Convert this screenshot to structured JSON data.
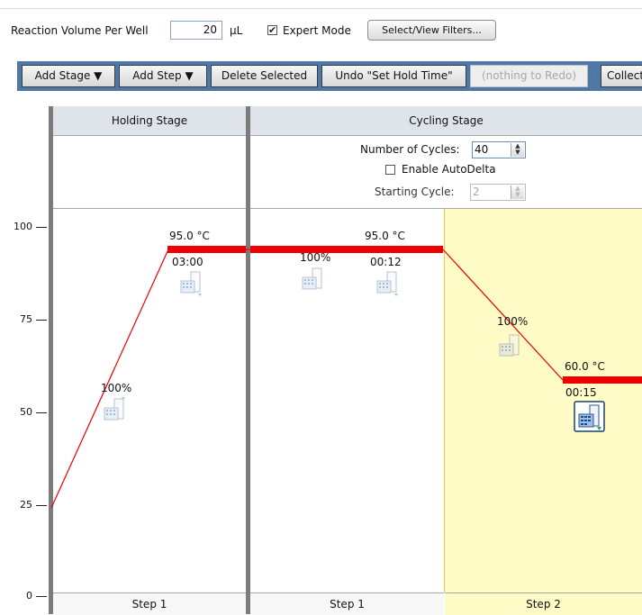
{
  "settings": {
    "volume_label": "Reaction Volume Per Well",
    "volume_value": "20",
    "volume_unit": "µL",
    "expert_mode_label": "Expert Mode",
    "expert_mode_checked": true,
    "filters_button": "Select/View Filters..."
  },
  "toolbar": {
    "add_stage": "Add Stage ▼",
    "add_step": "Add Step ▼",
    "delete_selected": "Delete Selected",
    "undo": "Undo \"Set Hold Time\"",
    "redo": "(nothing to Redo)",
    "collect": "Collect Data"
  },
  "y_axis": {
    "ticks": [
      "100",
      "75",
      "50",
      "25",
      "0"
    ]
  },
  "stages": {
    "holding": {
      "title": "Holding Stage",
      "steps": [
        {
          "label": "Step 1",
          "temp": "95.0 °C",
          "time": "03:00",
          "ramp": "100%"
        }
      ]
    },
    "cycling": {
      "title": "Cycling Stage",
      "cycles_label": "Number of Cycles:",
      "cycles_value": "40",
      "autodelta_label": "Enable AutoDelta",
      "autodelta_checked": false,
      "starting_cycle_label": "Starting Cycle:",
      "starting_cycle_value": "2",
      "steps": [
        {
          "label": "Step 1",
          "temp": "95.0 °C",
          "time": "00:12",
          "ramp": "100%"
        },
        {
          "label": "Step 2",
          "temp": "60.0 °C",
          "time": "00:15",
          "ramp": "100%"
        }
      ]
    }
  },
  "colors": {
    "toolbar_bg": "#4e78a8",
    "selected_step_bg": "#fffbc7",
    "hold_line": "#ee0000",
    "ramp_line": "#ee0000",
    "stage_divider": "#7c7c7c"
  }
}
